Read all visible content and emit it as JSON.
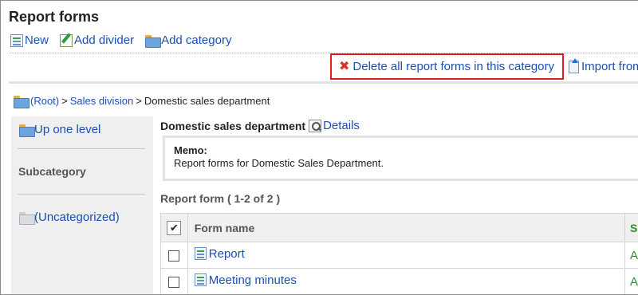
{
  "header": {
    "title": "Report forms"
  },
  "actions": {
    "new_label": "New",
    "add_divider_label": "Add divider",
    "add_category_label": "Add category"
  },
  "toolbar": {
    "delete_all_label": "Delete all report forms in this category",
    "import_label": "Import from"
  },
  "breadcrumb": {
    "root": "(Root)",
    "sep1": ">",
    "level1": "Sales division",
    "sep2": ">",
    "current": "Domestic sales department"
  },
  "sidebar": {
    "up_label": "Up one level",
    "subcategory_heading": "Subcategory",
    "uncategorized_label": "(Uncategorized)"
  },
  "category": {
    "name": "Domestic sales department",
    "details_label": "Details",
    "memo_label": "Memo:",
    "memo_text": "Report forms for Domestic Sales Department."
  },
  "report_list": {
    "heading": "Report form ( 1-2 of 2 )",
    "header_check": "✔",
    "col_form_name": "Form name",
    "col_status": "S",
    "rows": [
      {
        "name": "Report",
        "status": "A"
      },
      {
        "name": "Meeting minutes",
        "status": "A"
      }
    ]
  },
  "colors": {
    "link": "#1a4fb5",
    "highlight_border": "#e01e1e",
    "delete_icon": "#d8342a",
    "status": "#2e8b2e"
  }
}
